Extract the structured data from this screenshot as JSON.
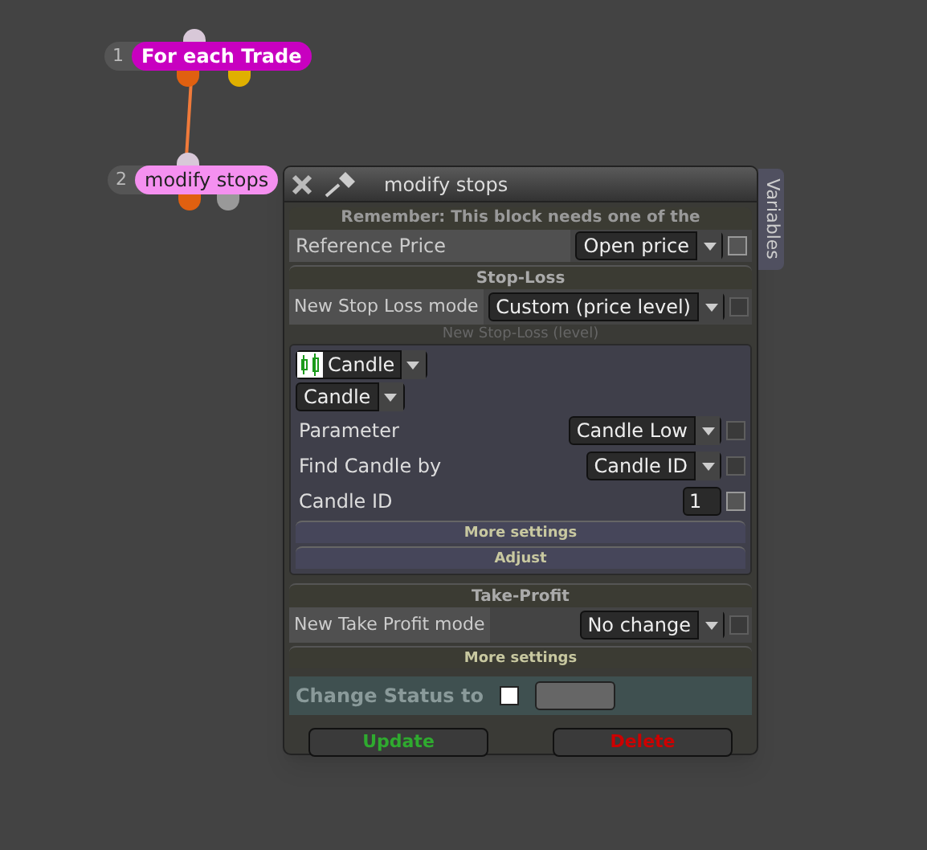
{
  "nodes": [
    {
      "number": "1",
      "label": "For each Trade",
      "selected": false
    },
    {
      "number": "2",
      "label": "modify stops",
      "selected": true
    }
  ],
  "panel": {
    "title": "modify stops",
    "side_tab": "Variables",
    "notice": "Remember: This block needs one of the",
    "reference": {
      "label": "Reference Price",
      "value": "Open price",
      "checkbox_enabled": true
    },
    "stop_loss": {
      "header": "Stop-Loss",
      "mode_label": "New Stop Loss mode",
      "mode_value": "Custom (price level)",
      "checkbox_enabled": false,
      "level_caption": "New Stop-Loss (level)",
      "source": "Candle",
      "sub_source": "Candle",
      "rows": [
        {
          "label": "Parameter",
          "kind": "dropdown",
          "value": "Candle Low",
          "checkbox_enabled": false
        },
        {
          "label": "Find Candle by",
          "kind": "dropdown",
          "value": "Candle ID",
          "checkbox_enabled": false
        },
        {
          "label": "Candle ID",
          "kind": "number",
          "value": "1",
          "checkbox_enabled": true
        }
      ],
      "sections": [
        "More settings",
        "Adjust"
      ]
    },
    "take_profit": {
      "header": "Take-Profit",
      "mode_label": "New Take Profit mode",
      "mode_value": "No change",
      "checkbox_enabled": false
    },
    "more_settings": "More settings",
    "status": {
      "label": "Change Status to",
      "checked": false
    },
    "buttons": [
      {
        "label": "Update",
        "kind": "update"
      },
      {
        "label": "Delete",
        "kind": "delete"
      }
    ]
  }
}
